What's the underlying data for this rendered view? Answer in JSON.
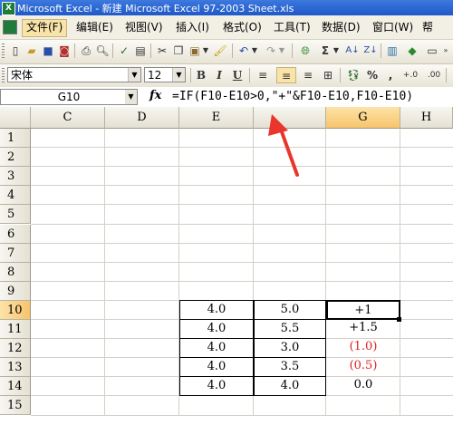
{
  "window": {
    "title": "Microsoft Excel - 新建 Microsoft Excel 97-2003 Sheet.xls",
    "app_icon": "excel-icon"
  },
  "menu": {
    "items": [
      "文件(F)",
      "编辑(E)",
      "视图(V)",
      "插入(I)",
      "格式(O)",
      "工具(T)",
      "数据(D)",
      "窗口(W)",
      "帮"
    ]
  },
  "format_toolbar": {
    "font": "宋体",
    "size": "12",
    "bold": "B",
    "italic": "I",
    "underline": "U",
    "percent": "%",
    "comma": ",",
    "inc_decimal": "+.0",
    "dec_decimal": ".00"
  },
  "standard_toolbar": {
    "sum": "Σ"
  },
  "formula_bar": {
    "name_box": "G10",
    "fx": "fx",
    "formula": "=IF(F10-E10>0,\"+\"&F10-E10,F10-E10)"
  },
  "sheet": {
    "columns": [
      "C",
      "D",
      "E",
      "",
      "G",
      "H"
    ],
    "rows": [
      "1",
      "2",
      "3",
      "4",
      "5",
      "6",
      "7",
      "8",
      "9",
      "10",
      "11",
      "12",
      "13",
      "14",
      "15"
    ],
    "active_cell": "G10",
    "data": [
      {
        "row": "10",
        "e": "4.0",
        "f": "5.0",
        "g": "+1"
      },
      {
        "row": "11",
        "e": "4.0",
        "f": "5.5",
        "g": "+1.5"
      },
      {
        "row": "12",
        "e": "4.0",
        "f": "3.0",
        "g": "(1.0)"
      },
      {
        "row": "13",
        "e": "4.0",
        "f": "3.5",
        "g": "(0.5)"
      },
      {
        "row": "14",
        "e": "4.0",
        "f": "4.0",
        "g": "0.0"
      }
    ]
  },
  "colors": {
    "annotation_arrow": "#e8362d",
    "negative_text": "#e21f1f",
    "selection_header": "#f7c46b"
  }
}
